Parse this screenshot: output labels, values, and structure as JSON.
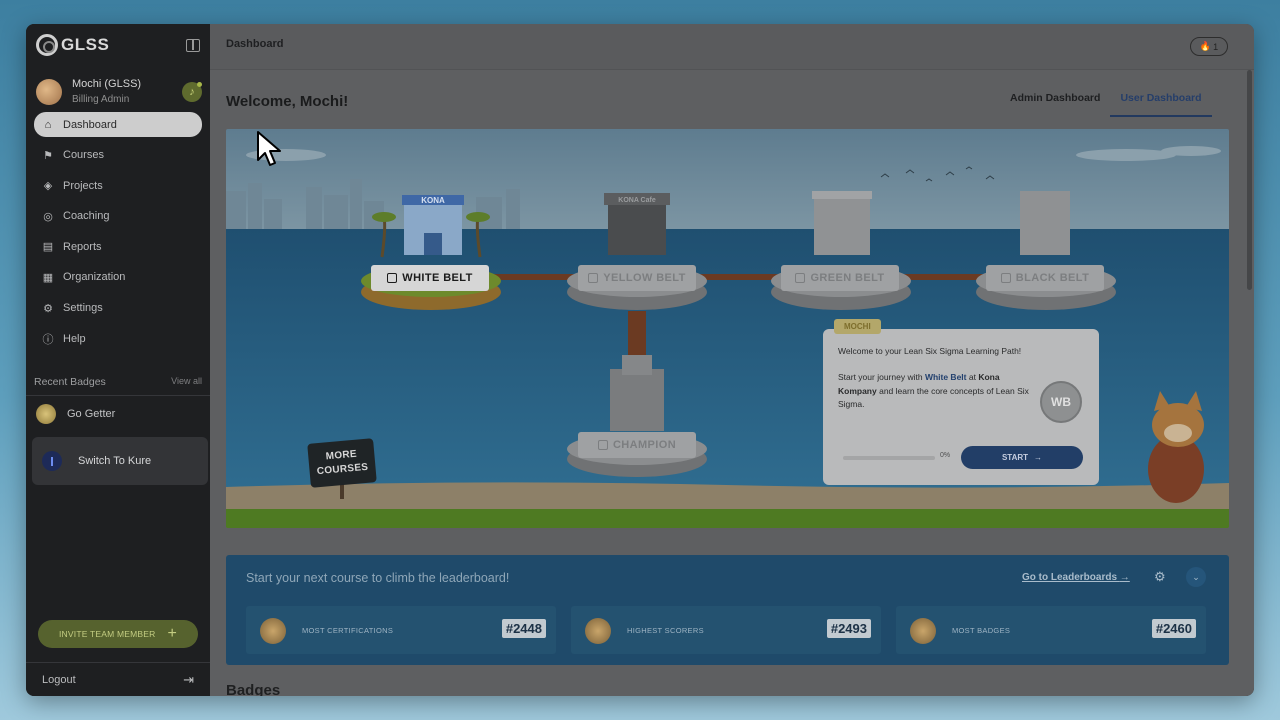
{
  "app": {
    "logo_text": "GLSS"
  },
  "user": {
    "name": "Mochi (GLSS)",
    "role": "Billing Admin"
  },
  "nav": [
    {
      "label": "Dashboard",
      "icon": "home-icon",
      "glyph": "⌂",
      "active": true
    },
    {
      "label": "Courses",
      "icon": "courses-icon",
      "glyph": "⚑",
      "active": false
    },
    {
      "label": "Projects",
      "icon": "projects-icon",
      "glyph": "◈",
      "active": false
    },
    {
      "label": "Coaching",
      "icon": "coaching-icon",
      "glyph": "◎",
      "active": false
    },
    {
      "label": "Reports",
      "icon": "reports-icon",
      "glyph": "▤",
      "active": false
    },
    {
      "label": "Organization",
      "icon": "organization-icon",
      "glyph": "▦",
      "active": false
    },
    {
      "label": "Settings",
      "icon": "gear-icon",
      "glyph": "⚙",
      "active": false
    },
    {
      "label": "Help",
      "icon": "help-icon",
      "glyph": "ⓘ",
      "active": false
    }
  ],
  "recent_badges": {
    "title": "Recent Badges",
    "view_all": "View all",
    "items": [
      "Go Getter"
    ]
  },
  "switch": {
    "label": "Switch To Kure"
  },
  "invite": {
    "label": "INVITE TEAM MEMBER"
  },
  "logout": {
    "label": "Logout"
  },
  "topbar": {
    "title": "Dashboard",
    "streak": "1"
  },
  "welcome": "Welcome, Mochi!",
  "tabs": [
    {
      "label": "Admin Dashboard",
      "active": false
    },
    {
      "label": "User Dashboard",
      "active": true
    }
  ],
  "path": {
    "islands": {
      "white": "WHITE BELT",
      "yellow": "YELLOW BELT",
      "green": "GREEN BELT",
      "black": "BLACK BELT",
      "champion": "CHAMPION"
    },
    "building_signs": {
      "kona": "KONA",
      "cafe": "KONA Cafe"
    },
    "more_courses_line1": "MORE",
    "more_courses_line2": "COURSES"
  },
  "mochi_card": {
    "tag": "MOCHI",
    "line1": "Welcome to your Lean Six Sigma Learning Path!",
    "p2_a": "Start your journey with ",
    "p2_highlight": "White Belt",
    "p2_b": " at ",
    "p2_bold": "Kona Kompany",
    "p2_c": " and learn the core concepts of Lean Six Sigma.",
    "badge": "WB",
    "progress": 0,
    "progress_label": "0%",
    "start_label": "START"
  },
  "leaderboard": {
    "title": "Start your next course to climb the leaderboard!",
    "link": "Go to Leaderboards",
    "stats": [
      {
        "label": "MOST CERTIFICATIONS",
        "rank": "#2448"
      },
      {
        "label": "HIGHEST SCORERS",
        "rank": "#2493"
      },
      {
        "label": "MOST BADGES",
        "rank": "#2460"
      }
    ]
  },
  "badges_heading": "Badges"
}
